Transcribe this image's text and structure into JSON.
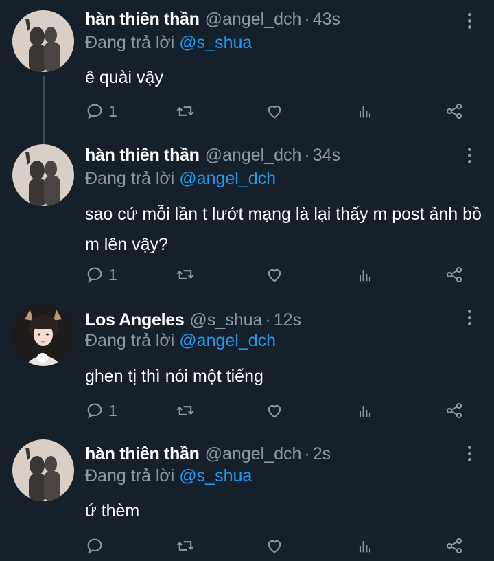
{
  "tweets": [
    {
      "name": "hàn thiên thần",
      "handle": "@angel_dch",
      "separator": "·",
      "time": "43s",
      "reply_prefix": "Đang trả lời",
      "reply_to": "@s_shua",
      "text": "ê quài vậy",
      "reply_count": "1",
      "avatar_icon": "shadow-selfie-avatar"
    },
    {
      "name": "hàn thiên thần",
      "handle": "@angel_dch",
      "separator": "·",
      "time": "34s",
      "reply_prefix": "Đang trả lời",
      "reply_to": "@angel_dch",
      "text": "sao cứ mỗi lần t lướt mạng là lại thấy m post ảnh bồ m lên vậy?",
      "reply_count": "1",
      "avatar_icon": "shadow-selfie-avatar"
    },
    {
      "name": "Los Angeles",
      "handle": "@s_shua",
      "separator": "·",
      "time": "12s",
      "reply_prefix": "Đang trả lời",
      "reply_to": "@angel_dch",
      "text": "ghen tị thì nói một tiếng",
      "reply_count": "1",
      "avatar_icon": "person-photo-avatar"
    },
    {
      "name": "hàn thiên thần",
      "handle": "@angel_dch",
      "separator": "·",
      "time": "2s",
      "reply_prefix": "Đang trả lời",
      "reply_to": "@s_shua",
      "text": "ứ thèm",
      "reply_count": "",
      "avatar_icon": "shadow-selfie-avatar"
    }
  ],
  "icons": {
    "reply": "reply-bubble-icon",
    "retweet": "retweet-icon",
    "like": "heart-icon",
    "views": "analytics-bars-icon",
    "share": "share-icon",
    "more": "more-vertical-icon"
  },
  "colors": {
    "background": "#15202b",
    "text": "#ffffff",
    "muted": "#8b98a5",
    "mention": "#1d9bf0",
    "thread_line": "#3d4b58"
  }
}
